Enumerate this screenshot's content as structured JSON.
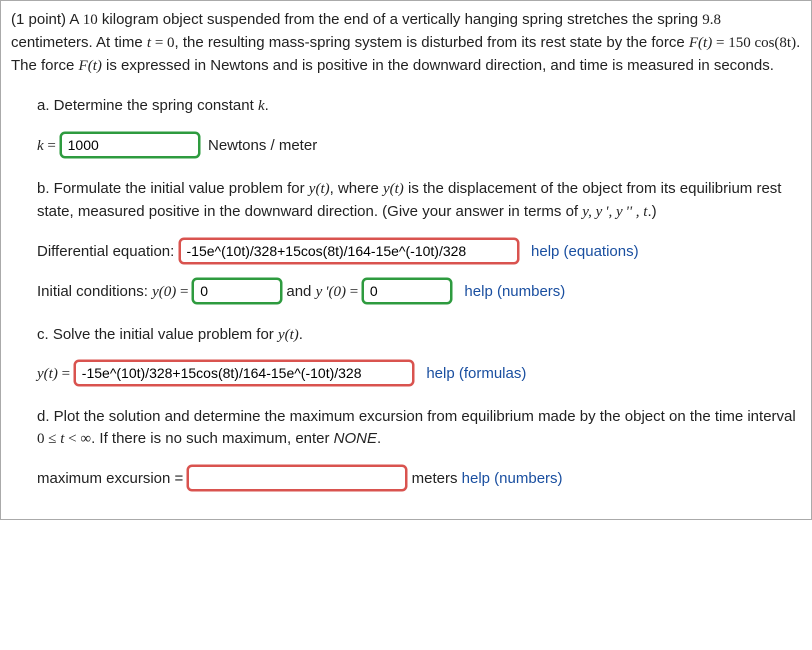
{
  "intro": {
    "points_label": "(1 point)",
    "text_before_mass": "A ",
    "mass": "10",
    "text_after_mass": " kilogram object suspended from the end of a vertically hanging spring stretches the spring ",
    "stretch": "9.8",
    "text_after_stretch": " centimeters. At time ",
    "time_var": "t",
    "eq_sign": " = ",
    "time_zero": "0",
    "text_after_t0": ", the resulting mass-spring system is disturbed from its rest state by the force ",
    "force_sym": "F(t)",
    "eq_sign2": " = ",
    "force_expr": "150 cos(8t)",
    "text_after_force": ". The force ",
    "force_sym2": "F(t)",
    "text_force_desc": " is expressed in Newtons and is positive in the downward direction, and time is measured in seconds."
  },
  "a": {
    "label": "a. Determine the spring constant ",
    "kvar": "k",
    "period": ".",
    "k_eq": "k",
    "equals": " = ",
    "value": "1000",
    "units": "Newtons / meter"
  },
  "b": {
    "label_pre": "b. Formulate the initial value problem for ",
    "yt": "y(t)",
    "label_mid": ", where ",
    "yt2": "y(t)",
    "label_rest": " is the displacement of the object from its equilibrium rest state, measured positive in the downward direction. (Give your answer in terms of ",
    "vars": "y, y ', y '' , t",
    "label_end": ".)",
    "diffeq_label": "Differential equation:",
    "diffeq_value": "-15e^(10t)/328+15cos(8t)/164-15e^(-10t)/328",
    "help_eq": "help (equations)",
    "ic_label_pre": "Initial conditions: ",
    "y0": "y(0)",
    "eq1": " = ",
    "y0_val": "0",
    "and": " and ",
    "yp0": "y '(0)",
    "eq2": " = ",
    "yp0_val": "0",
    "help_num": "help (numbers)"
  },
  "c": {
    "label_pre": "c. Solve the initial value problem for ",
    "yt": "y(t)",
    "period": ".",
    "yt_eq": "y(t)",
    "equals": " = ",
    "value": "-15e^(10t)/328+15cos(8t)/164-15e^(-10t)/328",
    "help": "help (formulas)"
  },
  "d": {
    "label_pre": "d. Plot the solution and determine the maximum excursion from equilibrium made by the object on the time interval ",
    "interval_lhs": "0",
    "le": " ≤ ",
    "tvar": "t",
    "lt": " < ",
    "inf": "∞",
    "label_mid": ". If there is no such maximum, enter ",
    "none": "NONE",
    "period": ".",
    "max_label": "maximum excursion =",
    "value": "",
    "units": "meters",
    "help": "help (numbers)"
  }
}
